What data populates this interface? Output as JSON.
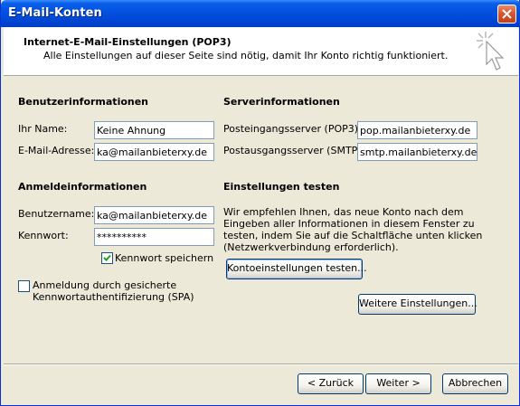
{
  "window": {
    "title": "E-Mail-Konten"
  },
  "header": {
    "title": "Internet-E-Mail-Einstellungen (POP3)",
    "subtitle": "Alle Einstellungen auf dieser Seite sind nötig, damit Ihr Konto richtig funktioniert."
  },
  "user_info": {
    "heading": "Benutzerinformationen",
    "name_label": "Ihr Name:",
    "name_value": "Keine Ahnung",
    "email_label": "E-Mail-Adresse:",
    "email_value": "ka@mailanbieterxy.de"
  },
  "server_info": {
    "heading": "Serverinformationen",
    "incoming_label": "Posteingangsserver (POP3):",
    "incoming_value": "pop.mailanbieterxy.de",
    "outgoing_label": "Postausgangsserver (SMTP):",
    "outgoing_value": "smtp.mailanbieterxy.de"
  },
  "login_info": {
    "heading": "Anmeldeinformationen",
    "username_label": "Benutzername:",
    "username_value": "ka@mailanbieterxy.de",
    "password_label": "Kennwort:",
    "password_value": "**********",
    "save_password_label": "Kennwort speichern",
    "save_password_checked": true,
    "spa_label_line1": "Anmeldung durch gesicherte",
    "spa_label_line2": "Kennwortauthentifizierung (SPA)",
    "spa_checked": false
  },
  "test_settings": {
    "heading": "Einstellungen testen",
    "desc_line1": "Wir empfehlen Ihnen, das neue Konto nach dem",
    "desc_line2": "Eingeben aller Informationen in diesem Fenster zu",
    "desc_line3": "testen, indem Sie auf die Schaltfläche unten klicken",
    "desc_line4": "(Netzwerkverbindung erforderlich).",
    "test_button": "Kontoeinstellungen testen..."
  },
  "more_settings_button": "Weitere Einstellungen...",
  "footer": {
    "back": "< Zurück",
    "next": "Weiter >",
    "cancel": "Abbrechen"
  },
  "colors": {
    "titlebar": "#0553e1",
    "dialog_bg": "#ece9d8",
    "field_border": "#7f9db9",
    "checkmark": "#21a121"
  },
  "icons": {
    "close": "close-icon",
    "wizard": "wizard-cursor-icon",
    "check": "checkmark-icon"
  }
}
